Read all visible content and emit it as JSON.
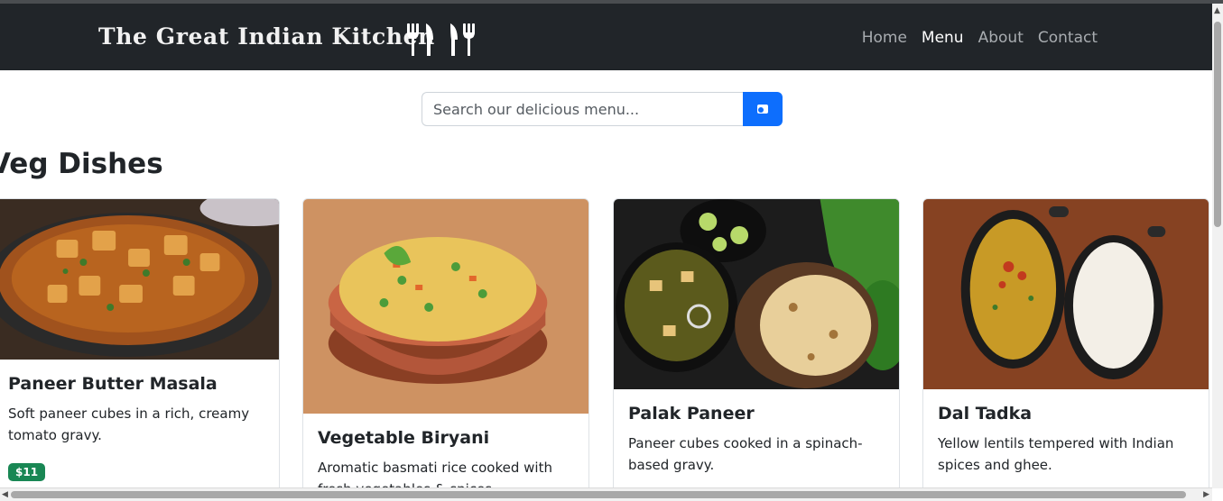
{
  "brand": {
    "title": "The Great Indian Kitchen"
  },
  "nav": {
    "items": [
      "Home",
      "Menu",
      "About",
      "Contact"
    ],
    "active": "Menu"
  },
  "search": {
    "placeholder": "Search our delicious menu...",
    "button_icon": "search-icon"
  },
  "section": {
    "title": "Veg Dishes"
  },
  "dishes": [
    {
      "name": "Paneer Butter Masala",
      "description": "Soft paneer cubes in a rich, creamy tomato gravy.",
      "price": "$11"
    },
    {
      "name": "Vegetable Biryani",
      "description": "Aromatic basmati rice cooked with fresh vegetables & spices."
    },
    {
      "name": "Palak Paneer",
      "description": "Paneer cubes cooked in a spinach-based gravy."
    },
    {
      "name": "Dal Tadka",
      "description": "Yellow lentils tempered with Indian spices and ghee."
    }
  ],
  "colors": {
    "navbar": "#212529",
    "accent": "#0d6efd",
    "price_badge": "#198754"
  }
}
